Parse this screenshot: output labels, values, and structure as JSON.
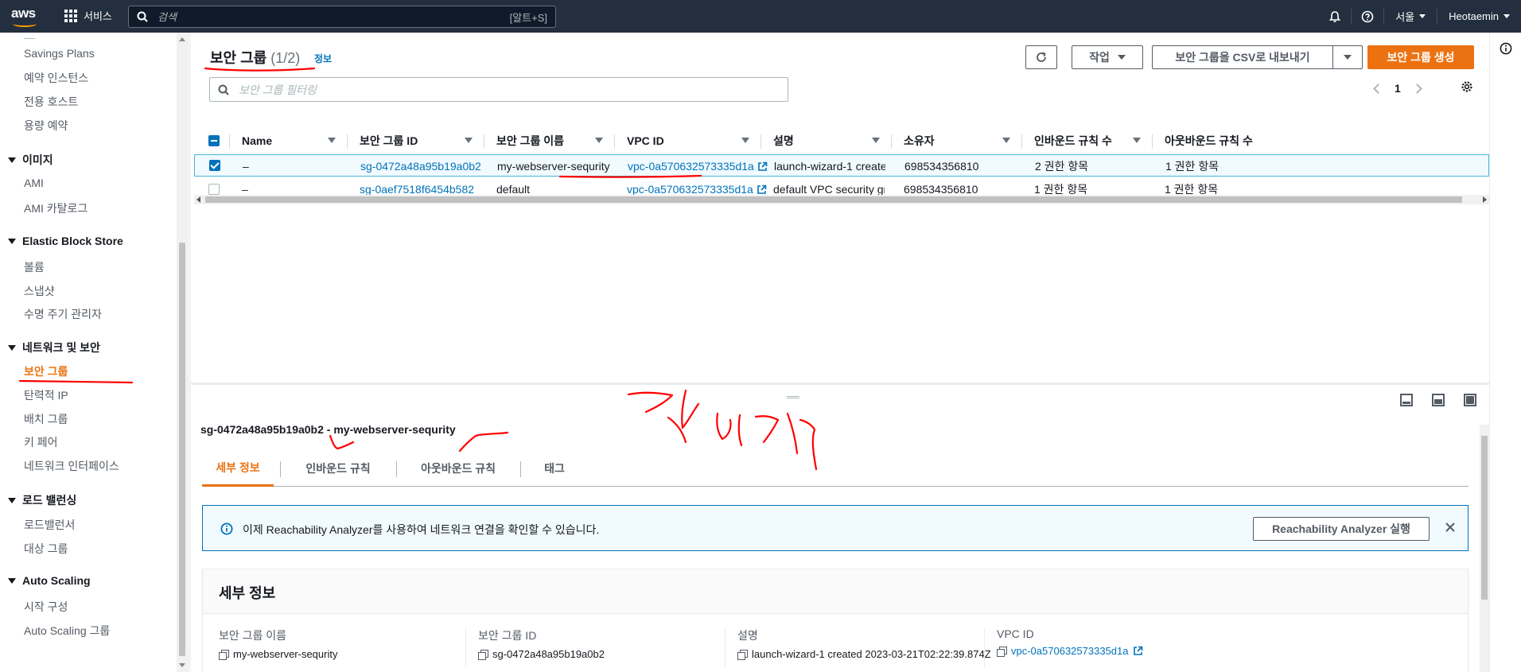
{
  "topnav": {
    "logo": "aws",
    "services_label": "서비스",
    "search_placeholder": "검색",
    "search_shortcut": "[알트+S]",
    "region": "서울",
    "user": "Heotaemin"
  },
  "sidebar": {
    "items_top": [
      "Savings Plans",
      "예약 인스턴스",
      "전용 호스트",
      "용량 예약"
    ],
    "sections": [
      {
        "title": "이미지",
        "items": [
          "AMI",
          "AMI 카탈로그"
        ]
      },
      {
        "title": "Elastic Block Store",
        "items": [
          "볼륨",
          "스냅샷",
          "수명 주기 관리자"
        ]
      },
      {
        "title": "네트워크 및 보안",
        "items": [
          "보안 그룹",
          "탄력적 IP",
          "배치 그룹",
          "키 페어",
          "네트워크 인터페이스"
        ]
      },
      {
        "title": "로드 밸런싱",
        "items": [
          "로드밸런서",
          "대상 그룹"
        ]
      },
      {
        "title": "Auto Scaling",
        "items": [
          "시작 구성",
          "Auto Scaling 그룹"
        ]
      }
    ],
    "active_item": "보안 그룹"
  },
  "main": {
    "title": "보안 그룹",
    "count": "(1/2)",
    "info_link": "정보",
    "buttons": {
      "refresh": "refresh-icon",
      "actions": "작업",
      "export": "보안 그룹을 CSV로 내보내기",
      "create": "보안 그룹 생성"
    },
    "filter_placeholder": "보안 그룹 필터링",
    "page": "1"
  },
  "table": {
    "columns": [
      "Name",
      "보안 그룹 ID",
      "보안 그룹 이름",
      "VPC ID",
      "설명",
      "소유자",
      "인바운드 규칙 수",
      "아웃바운드 규칙 수"
    ],
    "rows": [
      {
        "selected": true,
        "name": "–",
        "sg_id": "sg-0472a48a95b19a0b2",
        "sg_name": "my-webserver-sequrity",
        "vpc_id": "vpc-0a570632573335d1a",
        "desc": "launch-wizard-1 create…",
        "owner": "698534356810",
        "inbound": "2 권한 항목",
        "outbound": "1 권한 항목"
      },
      {
        "selected": false,
        "name": "–",
        "sg_id": "sg-0aef7518f6454b582",
        "sg_name": "default",
        "vpc_id": "vpc-0a570632573335d1a",
        "desc": "default VPC security gr…",
        "owner": "698534356810",
        "inbound": "1 권한 항목",
        "outbound": "1 권한 항목"
      }
    ]
  },
  "detail": {
    "title_id": "sg-0472a48a95b19a0b2",
    "title_sep": " - ",
    "title_name": "my-webserver-sequrity",
    "tabs": [
      "세부 정보",
      "인바운드 규칙",
      "아웃바운드 규칙",
      "태그"
    ],
    "active_tab": "세부 정보",
    "alert_text": "이제 Reachability Analyzer를 사용하여 네트워크 연결을 확인할 수 있습니다.",
    "alert_button": "Reachability Analyzer 실행",
    "card_title": "세부 정보",
    "fields": [
      {
        "label": "보안 그룹 이름",
        "value": "my-webserver-sequrity"
      },
      {
        "label": "보안 그룹 ID",
        "value": "sg-0472a48a95b19a0b2"
      },
      {
        "label": "설명",
        "value": "launch-wizard-1 created 2023-03-21T02:22:39.874Z"
      },
      {
        "label": "VPC ID",
        "value": "vpc-0a570632573335d1a"
      }
    ]
  },
  "colors": {
    "nav_bg": "#232f3e",
    "accent": "#ec7211",
    "link": "#0073bb",
    "annotation": "#ff0000"
  }
}
